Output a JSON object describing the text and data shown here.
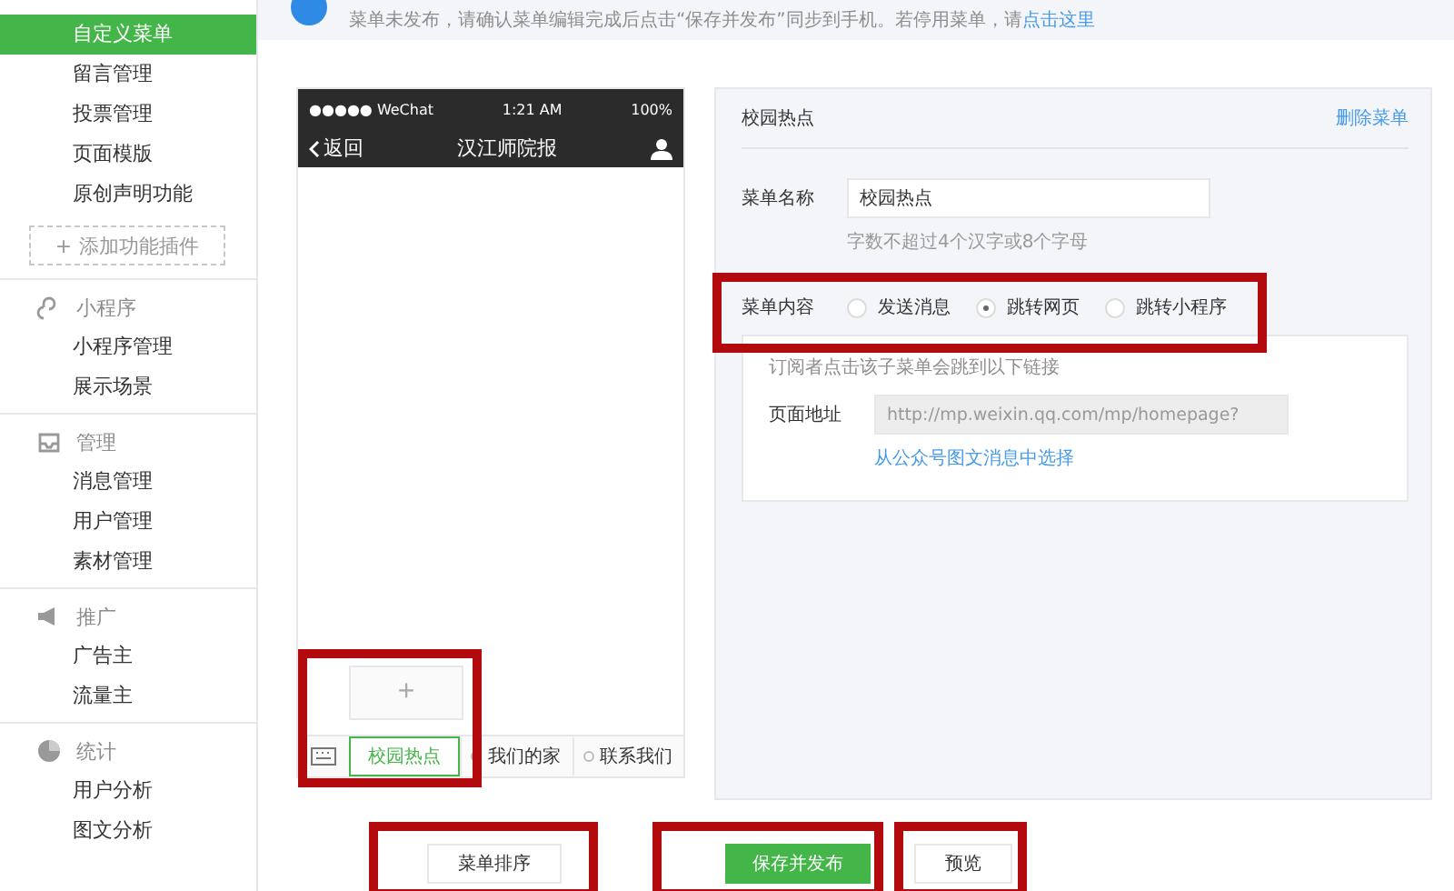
{
  "sidebar": {
    "groups": [
      {
        "kind": "plugins",
        "items": [
          {
            "label": "自定义菜单",
            "selected": true
          },
          {
            "label": "留言管理",
            "selected": false
          },
          {
            "label": "投票管理",
            "selected": false
          },
          {
            "label": "页面模版",
            "selected": false
          },
          {
            "label": "原创声明功能",
            "selected": false
          }
        ],
        "add_button": {
          "icon": "+",
          "label": "添加功能插件"
        }
      },
      {
        "kind": "miniprogram",
        "title": "小程序",
        "items": [
          {
            "label": "小程序管理",
            "selected": false
          },
          {
            "label": "展示场景",
            "selected": false
          }
        ]
      },
      {
        "kind": "manage",
        "title": "管理",
        "items": [
          {
            "label": "消息管理",
            "selected": false
          },
          {
            "label": "用户管理",
            "selected": false
          },
          {
            "label": "素材管理",
            "selected": false
          }
        ]
      },
      {
        "kind": "promote",
        "title": "推广",
        "items": [
          {
            "label": "广告主",
            "selected": false
          },
          {
            "label": "流量主",
            "selected": false
          }
        ]
      },
      {
        "kind": "stats",
        "title": "统计",
        "items": [
          {
            "label": "用户分析",
            "selected": false
          },
          {
            "label": "图文分析",
            "selected": false
          }
        ]
      }
    ]
  },
  "notice": {
    "text": "菜单未发布，请确认菜单编辑完成后点击“保存并发布”同步到手机。若停用菜单，请",
    "link": "点击这里"
  },
  "phone": {
    "status_bar": {
      "carrier": "●●●●● WeChat",
      "time": "1:21 AM",
      "battery": "100%"
    },
    "nav": {
      "back": "返回",
      "title": "汉江师院报"
    },
    "submenu_add": "+",
    "menu": [
      {
        "label": "校园热点",
        "selected": true,
        "has_submenu": false
      },
      {
        "label": "我们的家",
        "selected": false,
        "has_submenu": true
      },
      {
        "label": "联系我们",
        "selected": false,
        "has_submenu": true
      }
    ]
  },
  "editor": {
    "title": "校园热点",
    "delete_link": "删除菜单",
    "name_label": "菜单名称",
    "name_value": "校园热点",
    "name_hint": "字数不超过4个汉字或8个字母",
    "content_label": "菜单内容",
    "content_options": [
      {
        "label": "发送消息",
        "selected": false
      },
      {
        "label": "跳转网页",
        "selected": true
      },
      {
        "label": "跳转小程序",
        "selected": false
      }
    ],
    "link_box": {
      "description": "订阅者点击该子菜单会跳到以下链接",
      "url_label": "页面地址",
      "url_value": "http://mp.weixin.qq.com/mp/homepage?",
      "pick_link": "从公众号图文消息中选择"
    }
  },
  "actions": [
    {
      "label": "菜单排序",
      "primary": false
    },
    {
      "label": "保存并发布",
      "primary": true
    },
    {
      "label": "预览",
      "primary": false
    }
  ]
}
